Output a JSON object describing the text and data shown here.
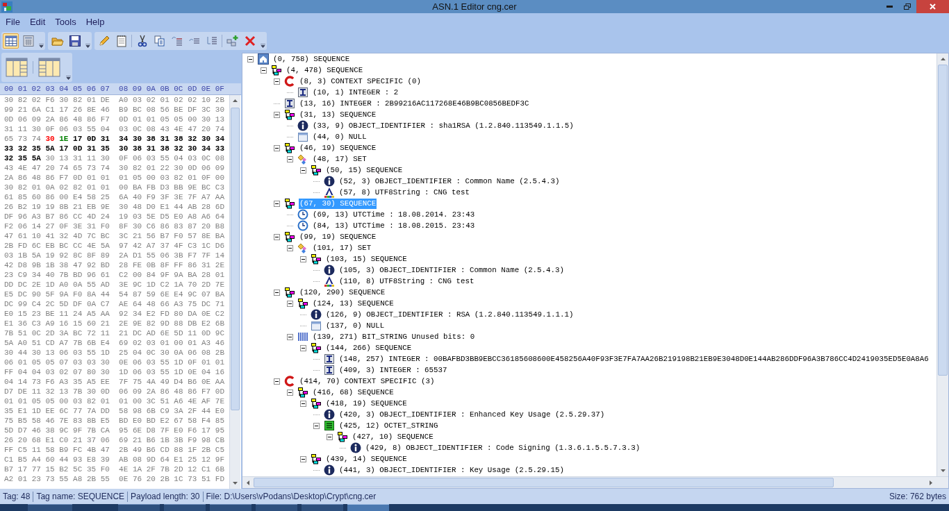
{
  "window": {
    "title": "ASN.1 Editor cng.cer"
  },
  "menu": [
    "File",
    "Edit",
    "Tools",
    "Help"
  ],
  "view_buttons": [
    {
      "selected": true
    },
    {
      "selected": false
    }
  ],
  "hex_header": [
    "00",
    "01",
    "02",
    "03",
    "04",
    "05",
    "06",
    "07",
    "08",
    "09",
    "0A",
    "0B",
    "0C",
    "0D",
    "0E",
    "0F"
  ],
  "hex_rows": [
    [
      {
        "kind": "plain",
        "text": "30 82 02 F6 30 82 01 DE A0 03 02 01 02 02 10 2B"
      }
    ],
    [
      {
        "kind": "plain",
        "text": "99 21 6A C1 17 26 8E 46 B9 BC 08 56 BE DF 3C 30"
      }
    ],
    [
      {
        "kind": "plain",
        "text": "0D 06 09 2A 86 48 86 F7 0D 01 01 05 05 00 30 13"
      }
    ],
    [
      {
        "kind": "plain",
        "text": "31 11 30 0F 06 03 55 04 03 0C 08 43 4E 47 20 74"
      }
    ],
    [
      {
        "kind": "plain",
        "text": "65 73 74"
      },
      {
        "kind": "tag",
        "text": "30"
      },
      {
        "kind": "length",
        "text": "1E"
      },
      {
        "kind": "payload",
        "text": "17 0D 31 34 30 38 31 38 32 30 34"
      }
    ],
    [
      {
        "kind": "payload",
        "text": "33 32 35 5A 17 0D 31 35 30 38 31 38 32 30 34 33"
      }
    ],
    [
      {
        "kind": "payload",
        "text": "32 35 5A"
      },
      {
        "kind": "plain",
        "text": "30 13 31 11 30 0F 06 03 55 04 03 0C 08"
      }
    ],
    [
      {
        "kind": "plain",
        "text": "43 4E 47 20 74 65 73 74 30 82 01 22 30 0D 06 09"
      }
    ],
    [
      {
        "kind": "plain",
        "text": "2A 86 48 86 F7 0D 01 01 01 05 00 03 82 01 0F 00"
      }
    ],
    [
      {
        "kind": "plain",
        "text": "30 82 01 0A 02 82 01 01 00 BA FB D3 BB 9E BC C3"
      }
    ],
    [
      {
        "kind": "plain",
        "text": "61 85 60 86 00 E4 58 25 6A 40 F9 3F 3E 7F A7 AA"
      }
    ],
    [
      {
        "kind": "plain",
        "text": "26 B2 19 19 8B 21 EB 9E 30 48 D0 E1 44 AB 28 6D"
      }
    ],
    [
      {
        "kind": "plain",
        "text": "DF 96 A3 B7 86 CC 4D 24 19 03 5E D5 E0 A8 A6 64"
      }
    ],
    [
      {
        "kind": "plain",
        "text": "F2 06 14 27 0F 3E 31 F0 8F 30 C6 86 83 87 20 B8"
      }
    ],
    [
      {
        "kind": "plain",
        "text": "47 61 10 41 32 4D 7C BC 3C 21 56 B7 F0 57 8E BA"
      }
    ],
    [
      {
        "kind": "plain",
        "text": "2B FD 6C EB BC CC 4E 5A 97 42 A7 37 4F C3 1C D6"
      }
    ],
    [
      {
        "kind": "plain",
        "text": "03 1B 5A 19 92 8C 8F 89 2A D1 55 06 3B F7 7F 14"
      }
    ],
    [
      {
        "kind": "plain",
        "text": "42 D8 9B 1B 38 47 92 BD 28 FE 0B 8F FF 86 31 2E"
      }
    ],
    [
      {
        "kind": "plain",
        "text": "23 C9 34 40 7B BD 96 61 C2 00 84 9F 9A BA 28 01"
      }
    ],
    [
      {
        "kind": "plain",
        "text": "DD DC 2E 1D A0 0A 55 AD 3E 9C 1D C2 1A 70 2D 7E"
      }
    ],
    [
      {
        "kind": "plain",
        "text": "E5 DC 90 5F 9A F0 8A 44 54 87 59 6E E4 9C 07 BA"
      }
    ],
    [
      {
        "kind": "plain",
        "text": "DC 99 C4 2C 5D DF 0A C7 AE 64 48 66 A3 75 DC 71"
      }
    ],
    [
      {
        "kind": "plain",
        "text": "E0 15 23 BE 11 24 A5 AA 92 34 E2 FD 80 DA 0E C2"
      }
    ],
    [
      {
        "kind": "plain",
        "text": "E1 36 C3 A9 16 15 60 21 2E 9E 82 9D 88 DB E2 6B"
      }
    ],
    [
      {
        "kind": "plain",
        "text": "7B 51 0C 2D 3A BC 72 11 21 DC AD 6E 5D 11 0D 9C"
      }
    ],
    [
      {
        "kind": "plain",
        "text": "5A A0 51 CD A7 7B 6B E4 69 02 03 01 00 01 A3 46"
      }
    ],
    [
      {
        "kind": "plain",
        "text": "30 44 30 13 06 03 55 1D 25 04 0C 30 0A 06 08 2B"
      }
    ],
    [
      {
        "kind": "plain",
        "text": "06 01 05 05 07 03 03 30 0E 06 03 55 1D 0F 01 01"
      }
    ],
    [
      {
        "kind": "plain",
        "text": "FF 04 04 03 02 07 80 30 1D 06 03 55 1D 0E 04 16"
      }
    ],
    [
      {
        "kind": "plain",
        "text": "04 14 73 F6 A3 35 A5 EE 7F 75 4A 49 D4 B6 0E AA"
      }
    ],
    [
      {
        "kind": "plain",
        "text": "D7 DE 11 32 13 7B 30 0D 06 09 2A 86 48 86 F7 0D"
      }
    ],
    [
      {
        "kind": "plain",
        "text": "01 01 05 05 00 03 82 01 01 00 3C 51 A6 4E AF 7E"
      }
    ],
    [
      {
        "kind": "plain",
        "text": "35 E1 1D EE 6C 77 7A DD 58 98 6B C9 3A 2F 44 E0"
      }
    ],
    [
      {
        "kind": "plain",
        "text": "75 B5 58 46 7E 83 8B E5 BD E0 BD E2 67 58 F4 85"
      }
    ],
    [
      {
        "kind": "plain",
        "text": "5D D7 46 38 9C 9F 7B CA 95 6E D8 7F E0 F6 17 95"
      }
    ],
    [
      {
        "kind": "plain",
        "text": "26 20 68 E1 C0 21 37 06 69 21 B6 1B 3B F9 98 CB"
      }
    ],
    [
      {
        "kind": "plain",
        "text": "FF C5 11 58 B9 FC 4B 47 2B 49 B6 CD 88 1F 2B C5"
      }
    ],
    [
      {
        "kind": "plain",
        "text": "C1 B5 A4 60 44 93 E8 39 AB 08 9D 64 E1 25 12 9F"
      }
    ],
    [
      {
        "kind": "plain",
        "text": "B7 17 77 15 B2 5C 35 F0 4E 1A 2F 7B 2D 12 C1 6B"
      }
    ],
    [
      {
        "kind": "plain",
        "text": "A2 01 23 73 55 A8 2B 55 0E 76 20 2B 1C 73 51 FD"
      }
    ]
  ],
  "tree": [
    {
      "kind": "root",
      "label": "(0, 758) SEQUENCE",
      "expanded": true,
      "selected": false,
      "children": [
        {
          "kind": "sequence",
          "label": "(4, 478) SEQUENCE",
          "expanded": true,
          "selected": false,
          "children": [
            {
              "kind": "context",
              "label": "(8, 3) CONTEXT SPECIFIC (0)",
              "expanded": true,
              "selected": false,
              "children": [
                {
                  "kind": "integer",
                  "label": "(10, 1) INTEGER : 2",
                  "selected": false
                }
              ]
            },
            {
              "kind": "integer",
              "label": "(13, 16) INTEGER : 2B99216AC117268E46B9BC0856BEDF3C",
              "selected": false
            },
            {
              "kind": "sequence",
              "label": "(31, 13) SEQUENCE",
              "expanded": true,
              "selected": false,
              "children": [
                {
                  "kind": "oid",
                  "label": "(33, 9) OBJECT_IDENTIFIER : sha1RSA (1.2.840.113549.1.1.5)",
                  "selected": false
                },
                {
                  "kind": "null",
                  "label": "(44, 0) NULL",
                  "selected": false
                }
              ]
            },
            {
              "kind": "sequence",
              "label": "(46, 19) SEQUENCE",
              "expanded": true,
              "selected": false,
              "children": [
                {
                  "kind": "set",
                  "label": "(48, 17) SET",
                  "expanded": true,
                  "selected": false,
                  "children": [
                    {
                      "kind": "sequence",
                      "label": "(50, 15) SEQUENCE",
                      "expanded": true,
                      "selected": false,
                      "children": [
                        {
                          "kind": "oid",
                          "label": "(52, 3) OBJECT_IDENTIFIER : Common Name (2.5.4.3)",
                          "selected": false
                        },
                        {
                          "kind": "string",
                          "label": "(57, 8) UTF8String : CNG test",
                          "selected": false
                        }
                      ]
                    }
                  ]
                }
              ]
            },
            {
              "kind": "sequence",
              "label": "(67, 30) SEQUENCE",
              "expanded": true,
              "selected": true,
              "children": [
                {
                  "kind": "time",
                  "label": "(69, 13) UTCTime : 18.08.2014. 23:43",
                  "selected": false
                },
                {
                  "kind": "time",
                  "label": "(84, 13) UTCTime : 18.08.2015. 23:43",
                  "selected": false
                }
              ]
            },
            {
              "kind": "sequence",
              "label": "(99, 19) SEQUENCE",
              "expanded": true,
              "selected": false,
              "children": [
                {
                  "kind": "set",
                  "label": "(101, 17) SET",
                  "expanded": true,
                  "selected": false,
                  "children": [
                    {
                      "kind": "sequence",
                      "label": "(103, 15) SEQUENCE",
                      "expanded": true,
                      "selected": false,
                      "children": [
                        {
                          "kind": "oid",
                          "label": "(105, 3) OBJECT_IDENTIFIER : Common Name (2.5.4.3)",
                          "selected": false
                        },
                        {
                          "kind": "string",
                          "label": "(110, 8) UTF8String : CNG test",
                          "selected": false
                        }
                      ]
                    }
                  ]
                }
              ]
            },
            {
              "kind": "sequence",
              "label": "(120, 290) SEQUENCE",
              "expanded": true,
              "selected": false,
              "children": [
                {
                  "kind": "sequence",
                  "label": "(124, 13) SEQUENCE",
                  "expanded": true,
                  "selected": false,
                  "children": [
                    {
                      "kind": "oid",
                      "label": "(126, 9) OBJECT_IDENTIFIER : RSA (1.2.840.113549.1.1.1)",
                      "selected": false
                    },
                    {
                      "kind": "null",
                      "label": "(137, 0) NULL",
                      "selected": false
                    }
                  ]
                },
                {
                  "kind": "bitstring",
                  "label": "(139, 271) BIT_STRING Unused bits: 0",
                  "expanded": true,
                  "selected": false,
                  "children": [
                    {
                      "kind": "sequence",
                      "label": "(144, 266) SEQUENCE",
                      "expanded": true,
                      "selected": false,
                      "children": [
                        {
                          "kind": "integer",
                          "label": "(148, 257) INTEGER : 00BAFBD3BB9EBCC36185608600E458256A40F93F3E7FA7AA26B219198B21EB9E3048D0E144AB286DDF96A3B786CC4D2419035ED5E0A8A6",
                          "selected": false
                        },
                        {
                          "kind": "integer",
                          "label": "(409, 3) INTEGER : 65537",
                          "selected": false
                        }
                      ]
                    }
                  ]
                }
              ]
            },
            {
              "kind": "context",
              "label": "(414, 70) CONTEXT SPECIFIC (3)",
              "expanded": true,
              "selected": false,
              "children": [
                {
                  "kind": "sequence",
                  "label": "(416, 68) SEQUENCE",
                  "expanded": true,
                  "selected": false,
                  "children": [
                    {
                      "kind": "sequence",
                      "label": "(418, 19) SEQUENCE",
                      "expanded": true,
                      "selected": false,
                      "children": [
                        {
                          "kind": "oid",
                          "label": "(420, 3) OBJECT_IDENTIFIER : Enhanced Key Usage (2.5.29.37)",
                          "selected": false
                        },
                        {
                          "kind": "octet",
                          "label": "(425, 12) OCTET_STRING",
                          "expanded": true,
                          "selected": false,
                          "children": [
                            {
                              "kind": "sequence",
                              "label": "(427, 10) SEQUENCE",
                              "expanded": true,
                              "selected": false,
                              "children": [
                                {
                                  "kind": "oid",
                                  "label": "(429, 8) OBJECT_IDENTIFIER : Code Signing (1.3.6.1.5.5.7.3.3)",
                                  "selected": false
                                }
                              ]
                            }
                          ]
                        }
                      ]
                    },
                    {
                      "kind": "sequence",
                      "label": "(439, 14) SEQUENCE",
                      "expanded": true,
                      "selected": false,
                      "children": [
                        {
                          "kind": "oid",
                          "label": "(441, 3) OBJECT_IDENTIFIER : Key Usage (2.5.29.15)",
                          "selected": false
                        }
                      ]
                    }
                  ]
                }
              ]
            }
          ]
        }
      ]
    }
  ],
  "status_bar": {
    "fields": [
      "Tag: 48",
      "Tag name: SEQUENCE",
      "Payload length: 30",
      "File: D:\\Users\\vPodans\\Desktop\\Crypt\\cng.cer"
    ],
    "size": "Size: 762 bytes"
  }
}
